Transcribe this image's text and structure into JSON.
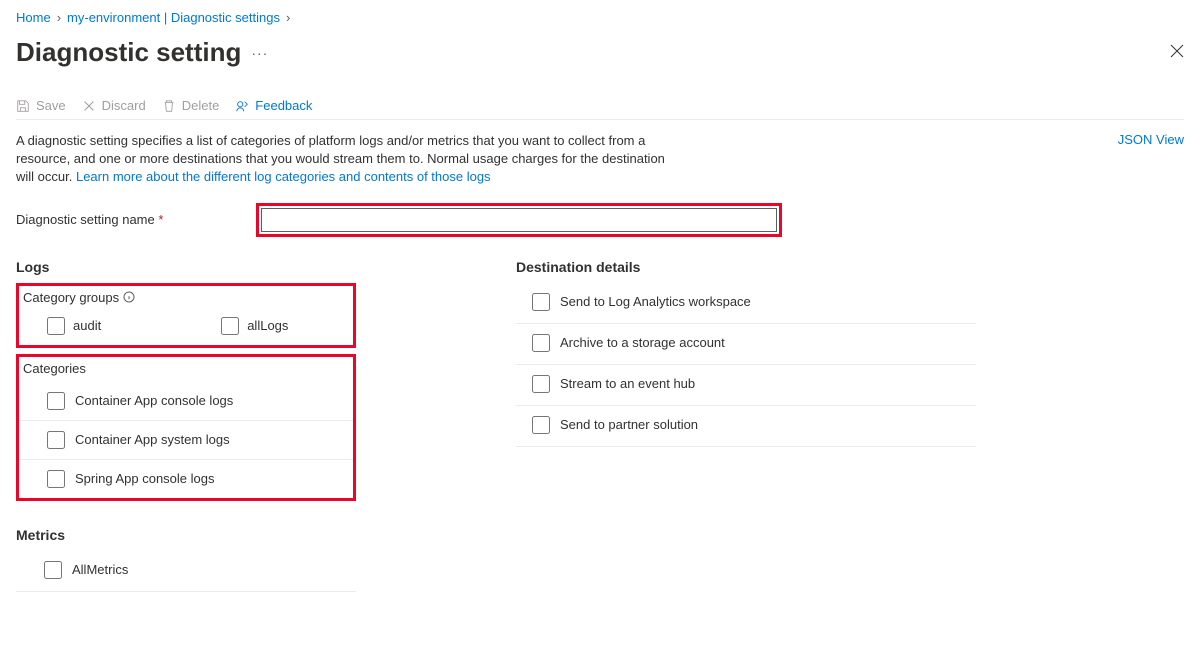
{
  "breadcrumb": {
    "home": "Home",
    "env": "my-environment | Diagnostic settings"
  },
  "page": {
    "title": "Diagnostic setting"
  },
  "toolbar": {
    "save": "Save",
    "discard": "Discard",
    "delete": "Delete",
    "feedback": "Feedback"
  },
  "description": {
    "text": "A diagnostic setting specifies a list of categories of platform logs and/or metrics that you want to collect from a resource, and one or more destinations that you would stream them to. Normal usage charges for the destination will occur. ",
    "link": "Learn more about the different log categories and contents of those logs"
  },
  "json_view": "JSON View",
  "form": {
    "name_label": "Diagnostic setting name",
    "name_value": ""
  },
  "logs": {
    "heading": "Logs",
    "groups_heading": "Category groups",
    "groups": [
      {
        "label": "audit"
      },
      {
        "label": "allLogs"
      }
    ],
    "categories_heading": "Categories",
    "categories": [
      {
        "label": "Container App console logs"
      },
      {
        "label": "Container App system logs"
      },
      {
        "label": "Spring App console logs"
      }
    ]
  },
  "destinations": {
    "heading": "Destination details",
    "items": [
      {
        "label": "Send to Log Analytics workspace"
      },
      {
        "label": "Archive to a storage account"
      },
      {
        "label": "Stream to an event hub"
      },
      {
        "label": "Send to partner solution"
      }
    ]
  },
  "metrics": {
    "heading": "Metrics",
    "items": [
      {
        "label": "AllMetrics"
      }
    ]
  }
}
